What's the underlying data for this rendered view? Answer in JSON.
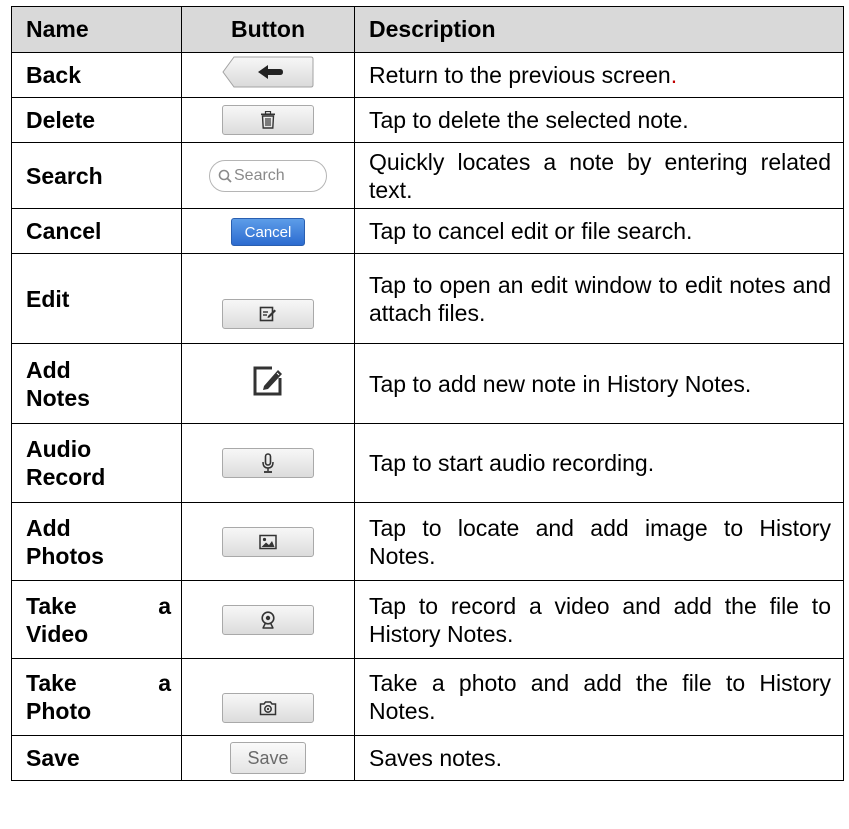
{
  "table": {
    "headers": [
      "Name",
      "Button",
      "Description"
    ],
    "rows": [
      {
        "name": "Back",
        "icon": "back-arrow-icon",
        "description": "Return to the previous screen",
        "trailing": "."
      },
      {
        "name": "Delete",
        "icon": "trash-icon",
        "description": "Tap to delete the selected note."
      },
      {
        "name": "Search",
        "icon": "search-icon",
        "button_text": "Search",
        "description": "Quickly locates a note by entering related text."
      },
      {
        "name": "Cancel",
        "icon": "cancel-button",
        "button_text": "Cancel",
        "description": "Tap to cancel edit or file search."
      },
      {
        "name": "Edit",
        "icon": "edit-icon",
        "description": "Tap to open an edit window to edit notes and attach files."
      },
      {
        "name_line1": "Add",
        "name_line2": "Notes",
        "icon": "add-note-icon",
        "description": "Tap to add new note in History Notes."
      },
      {
        "name_line1": "Audio",
        "name_line2": "Record",
        "icon": "microphone-icon",
        "description": "Tap to start audio recording."
      },
      {
        "name_line1": "Add",
        "name_line2": "Photos",
        "icon": "image-icon",
        "description": "Tap to locate and add image to History Notes."
      },
      {
        "name_l1a": "Take",
        "name_l1b": "a",
        "name_line2": "Video",
        "icon": "webcam-icon",
        "description": "Tap to record a video and add the file to History Notes."
      },
      {
        "name_l1a": "Take",
        "name_l1b": "a",
        "name_line2": "Photo",
        "icon": "camera-icon",
        "description": "Take a photo and add the file to History Notes."
      },
      {
        "name": "Save",
        "icon": "save-button",
        "button_text": "Save",
        "description": "Saves notes."
      }
    ]
  }
}
